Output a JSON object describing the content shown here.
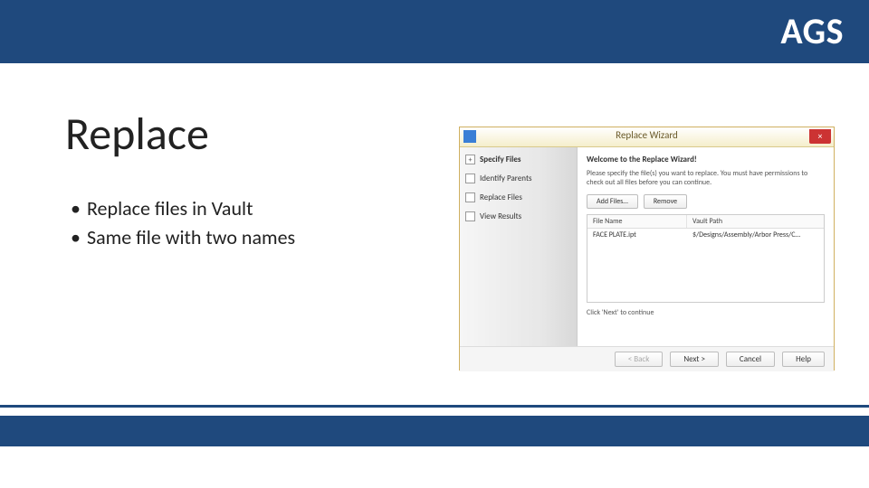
{
  "header": {
    "brand": "AGS"
  },
  "title": "Replace",
  "bullets": [
    "Replace files in Vault",
    "Same file with two names"
  ],
  "dialog": {
    "title": "Replace Wizard",
    "close_label": "×",
    "steps": [
      {
        "label": "Specify Files",
        "active": true
      },
      {
        "label": "Identify Parents",
        "active": false
      },
      {
        "label": "Replace Files",
        "active": false
      },
      {
        "label": "View Results",
        "active": false
      }
    ],
    "welcome": "Welcome to the Replace Wizard!",
    "description": "Please specify the file(s) you want to replace. You must have permissions to check out all files before you can continue.",
    "add_files_label": "Add Files…",
    "remove_label": "Remove",
    "column_file": "File Name",
    "column_path": "Vault Path",
    "row_file": "FACE PLATE.ipt",
    "row_path": "$/Designs/Assembly/Arbor Press/C…",
    "hint": "Click 'Next' to continue",
    "back_label": "< Back",
    "next_label": "Next >",
    "cancel_label": "Cancel",
    "help_label": "Help"
  }
}
